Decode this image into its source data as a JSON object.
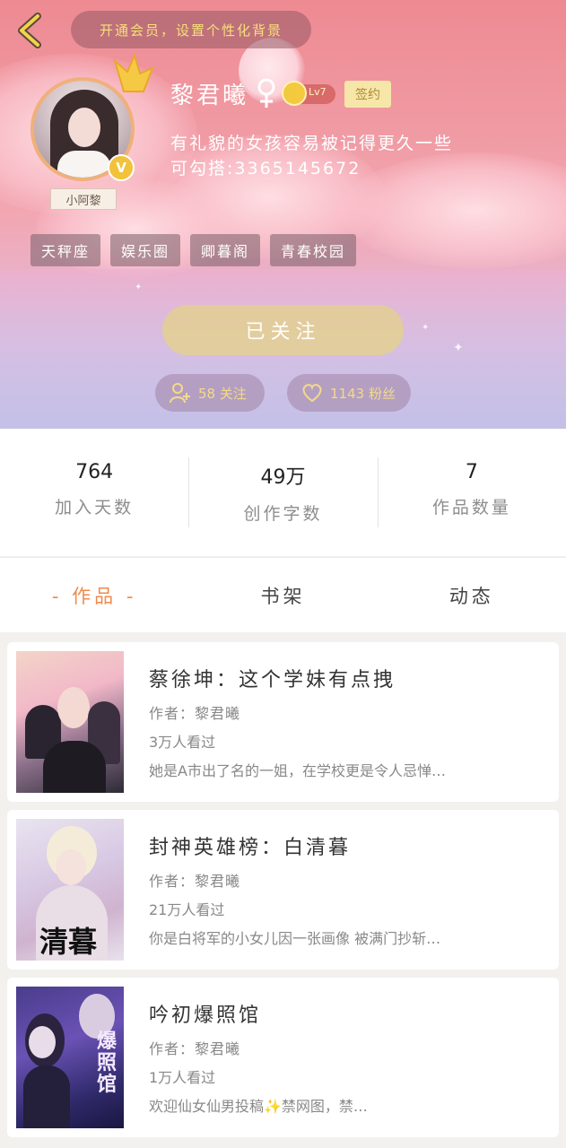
{
  "header": {
    "vip_banner": "开通会员，设置个性化背景",
    "avatar_nickname_tag": "小阿黎",
    "username": "黎君曦",
    "level": "Lv7",
    "sign_badge": "签约",
    "bio_line1": "有礼貌的女孩容易被记得更久一些",
    "bio_line2": "可勾搭:3365145672",
    "tags": [
      "天秤座",
      "娱乐圈",
      "卿暮阁",
      "青春校园"
    ],
    "follow_button": "已关注",
    "following_text": "58 关注",
    "fans_text": "1143 粉丝"
  },
  "stats": [
    {
      "value": "764",
      "label": "加入天数"
    },
    {
      "value": "49万",
      "label": "创作字数"
    },
    {
      "value": "7",
      "label": "作品数量"
    }
  ],
  "tabs": [
    "- 作品 -",
    "书架",
    "动态"
  ],
  "works": [
    {
      "title": "蔡徐坤：这个学妹有点拽",
      "author": "作者：黎君曦",
      "views": "3万人看过",
      "desc": "她是A市出了名的一姐，在学校更是令人忌惮…"
    },
    {
      "title": "封神英雄榜：白清暮",
      "author": "作者：黎君曦",
      "views": "21万人看过",
      "desc": "你是白将军的小女儿因一张画像 被满门抄斩…"
    },
    {
      "title": "吟初爆照馆",
      "author": "作者：黎君曦",
      "views": "1万人看过",
      "desc": "欢迎仙女仙男投稿✨禁网图，禁…"
    }
  ],
  "covers": [
    "清暮",
    "爆照馆"
  ],
  "colors": {
    "accent": "#f08a4b",
    "vip_text": "#f6e07a",
    "follow_button": "#e2ce96",
    "pill_text": "#f4d98a"
  }
}
